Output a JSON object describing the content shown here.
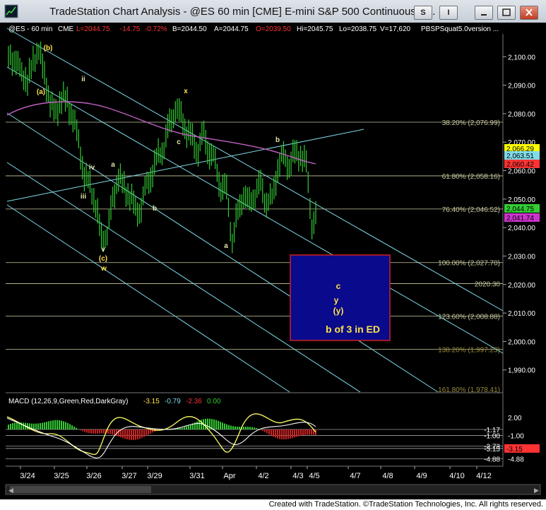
{
  "window": {
    "title": "TradeStation Chart Analysis - @ES 60 min [CME] E-mini S&P 500 Continuous C...",
    "btn_s": "S",
    "btn_i": "I",
    "footer": "Created with TradeStation. ©TradeStation Technologies, Inc. All rights reserved."
  },
  "header": {
    "symbol": "@ES - 60 min",
    "exchange": "CME",
    "last": "L=2044.75",
    "change": "-14.75",
    "pct": "-0.72%",
    "bid": "B=2044.50",
    "ask": "A=2044.75",
    "open": "O=2039.50",
    "high": "Hi=2045.75",
    "low": "Lo=2038.75",
    "volume": "V=17,620",
    "indicator": "PBSPSquat5.0version ..."
  },
  "colors": {
    "bg": "#000000",
    "bars": "#33cc33",
    "fib": "#c9c9a0",
    "channel": "#7fdbe8",
    "ma": "#c060c0",
    "box": "#0a0a8c",
    "boxborder": "#cc2222",
    "wave": "#ffe24a"
  },
  "chart_data": [
    {
      "type": "line",
      "title": "@ES 60 min",
      "ylim": [
        1982,
        2108
      ],
      "y_ticks": [
        "2,100.00",
        "2,090.00",
        "2,080.00",
        "2,070.00",
        "2,060.00",
        "2,050.00",
        "2,040.00",
        "2,030.00",
        "2,020.00",
        "2,010.00",
        "2,000.00",
        "1,990.00"
      ],
      "x_ticks": [
        "3/24",
        "3/25",
        "3/26",
        "3/27",
        "3/29",
        "3/31",
        "Apr",
        "4/2",
        "4/3",
        "4/5",
        "4/7",
        "4/8",
        "4/9",
        "4/10",
        "4/12"
      ],
      "series": [
        {
          "approx_closes": [
            2100,
            2098,
            2095,
            2090,
            2099,
            2102,
            2094,
            2083,
            2081,
            2085,
            2084,
            2079,
            2070,
            2058,
            2055,
            2048,
            2036,
            2038,
            2050,
            2058,
            2054,
            2052,
            2045,
            2048,
            2055,
            2060,
            2065,
            2069,
            2076,
            2082,
            2079,
            2074,
            2070,
            2068,
            2072,
            2067,
            2062,
            2055,
            2052,
            2036,
            2045,
            2052,
            2048,
            2053,
            2054,
            2050,
            2049,
            2062,
            2064,
            2063,
            2065,
            2066,
            2062,
            2041,
            2045
          ]
        }
      ],
      "price_labels": [
        {
          "value": 2066.29,
          "text": "2,066.29",
          "color": "#ffff00"
        },
        {
          "value": 2063.51,
          "text": "2,063.51",
          "color": "#7fdbe8"
        },
        {
          "value": 2060.42,
          "text": "2,060.42",
          "color": "#ff3333"
        },
        {
          "value": 2044.75,
          "text": "2,044.75",
          "color": "#33cc33"
        },
        {
          "value": 2041.74,
          "text": "2,041.74",
          "color": "#cc33cc"
        }
      ],
      "fib_levels": [
        {
          "value": 2076.99,
          "label": "38.20% (2,076.99)"
        },
        {
          "value": 2058.16,
          "label": "61.80% (2,058.16)"
        },
        {
          "value": 2046.52,
          "label": "76.40% (2,046.52)"
        },
        {
          "value": 2027.7,
          "label": "100.00% (2,027.70)"
        },
        {
          "value": 2020.3,
          "label": "2020.30"
        },
        {
          "value": 2008.88,
          "label": "123.60% (2,008.88)"
        },
        {
          "value": 1997.23,
          "label": "138.20% (1,997.23)"
        },
        {
          "value": 1978.41,
          "label": "161.80% (1,978.41)"
        }
      ],
      "wave_labels": [
        "(b)",
        "(a)",
        "ii",
        "iv",
        "iii",
        "a",
        "b",
        "v",
        "(c)",
        "w",
        "x",
        "c",
        "a",
        "b",
        "c",
        "y",
        "(y)"
      ],
      "box_text": "b of 3 in ED"
    },
    {
      "type": "line",
      "title": "MACD (12,26,9,Green,Red,DarkGray)",
      "readouts": [
        "-3.15",
        "-0.79",
        "-2.36",
        "0.00"
      ],
      "ylim": [
        -5.5,
        3.5
      ],
      "y_ticks": [
        "2.00",
        "-1.00",
        "-4.88"
      ],
      "levels": [
        {
          "value": 0.0,
          "label": "-1.17"
        },
        {
          "value": -1.0,
          "label": "-1.00"
        },
        {
          "value": -2.73,
          "label": "-2.73"
        },
        {
          "value": -3.15,
          "label": "-3.15"
        },
        {
          "value": -4.88,
          "label": "-4.88"
        }
      ]
    }
  ]
}
